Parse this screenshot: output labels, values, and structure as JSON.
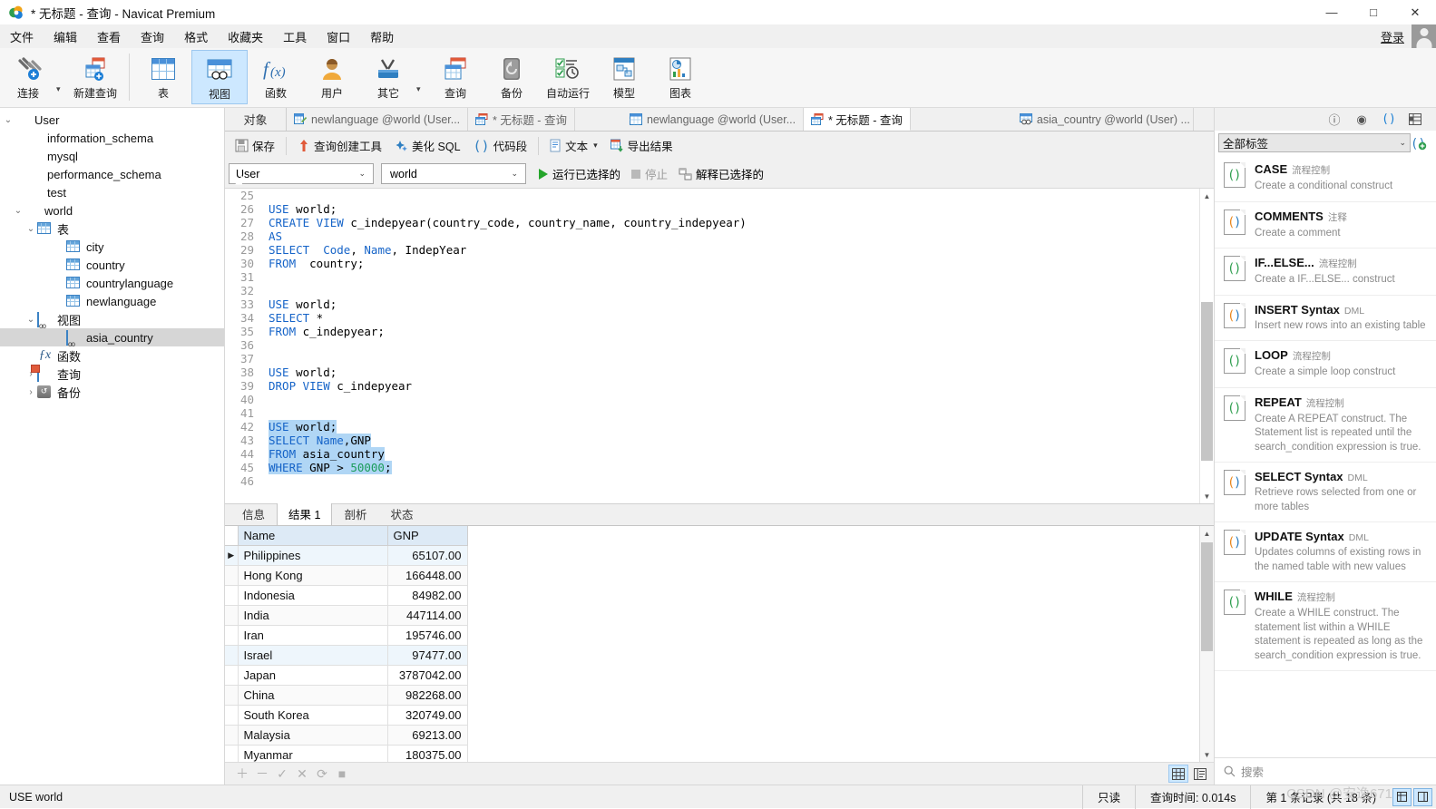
{
  "window": {
    "title": "* 无标题 - 查询 - Navicat Premium",
    "minimize": "—",
    "maximize": "□",
    "close": "✕"
  },
  "menubar": {
    "items": [
      "文件",
      "编辑",
      "查看",
      "查询",
      "格式",
      "收藏夹",
      "工具",
      "窗口",
      "帮助"
    ],
    "login_label": "登录"
  },
  "toolbar": {
    "buttons": [
      {
        "label": "连接",
        "icon": "connection-icon",
        "caret": true
      },
      {
        "label": "新建查询",
        "icon": "new-query-icon",
        "caret": false
      },
      {
        "label": "表",
        "icon": "table-icon",
        "caret": false
      },
      {
        "label": "视图",
        "icon": "view-icon",
        "caret": false,
        "active": true
      },
      {
        "label": "函数",
        "icon": "function-icon",
        "caret": false
      },
      {
        "label": "用户",
        "icon": "user-icon",
        "caret": false
      },
      {
        "label": "其它",
        "icon": "other-tools-icon",
        "caret": true
      },
      {
        "label": "查询",
        "icon": "query-icon",
        "caret": false
      },
      {
        "label": "备份",
        "icon": "backup-icon",
        "caret": false
      },
      {
        "label": "自动运行",
        "icon": "automation-icon",
        "caret": false
      },
      {
        "label": "模型",
        "icon": "model-icon",
        "caret": false
      },
      {
        "label": "图表",
        "icon": "chart-icon",
        "caret": false
      }
    ]
  },
  "sidebar": {
    "nodes": [
      {
        "label": "User",
        "level": 0,
        "icon": "navicat-connection-icon",
        "twist": "v"
      },
      {
        "label": "information_schema",
        "level": 1,
        "icon": "database-icon",
        "twist": ""
      },
      {
        "label": "mysql",
        "level": 1,
        "icon": "database-icon",
        "twist": ""
      },
      {
        "label": "performance_schema",
        "level": 1,
        "icon": "database-icon",
        "twist": ""
      },
      {
        "label": "test",
        "level": 1,
        "icon": "database-icon",
        "twist": ""
      },
      {
        "label": "world",
        "level": 1,
        "icon": "database-icon-open",
        "twist": "v"
      },
      {
        "label": "表",
        "level": 2,
        "icon": "tables-folder-icon",
        "twist": "v"
      },
      {
        "label": "city",
        "level": 3,
        "icon": "table-icon",
        "twist": ""
      },
      {
        "label": "country",
        "level": 3,
        "icon": "table-icon",
        "twist": ""
      },
      {
        "label": "countrylanguage",
        "level": 3,
        "icon": "table-icon",
        "twist": ""
      },
      {
        "label": "newlanguage",
        "level": 3,
        "icon": "table-icon",
        "twist": ""
      },
      {
        "label": "视图",
        "level": 2,
        "icon": "views-folder-icon",
        "twist": "v"
      },
      {
        "label": "asia_country",
        "level": 3,
        "icon": "view-icon",
        "twist": "",
        "selected": true
      },
      {
        "label": "函数",
        "level": 2,
        "icon": "function-icon",
        "twist": ""
      },
      {
        "label": "查询",
        "level": 2,
        "icon": "query-icon",
        "twist": ">"
      },
      {
        "label": "备份",
        "level": 2,
        "icon": "backup-icon",
        "twist": ">"
      }
    ]
  },
  "tabs": {
    "object_label": "对象",
    "items": [
      {
        "label": "newlanguage @world (User...",
        "icon": "table-edit-icon",
        "active": false
      },
      {
        "label": "* 无标题 - 查询",
        "icon": "query-icon",
        "active": false
      },
      {
        "label": "newlanguage @world (User...",
        "icon": "table-icon",
        "active": false
      },
      {
        "label": "* 无标题 - 查询",
        "icon": "query-icon",
        "active": true
      },
      {
        "label": "asia_country @world (User) ...",
        "icon": "view-icon",
        "active": false
      }
    ]
  },
  "query_toolbar": {
    "save": "保存",
    "query_builder": "查询创建工具",
    "beautify_sql": "美化 SQL",
    "code_snippet": "代码段",
    "text": "文本",
    "export_result": "导出结果"
  },
  "query_bar": {
    "connection": "User",
    "database": "world",
    "run_selected": "运行已选择的",
    "stop": "停止",
    "explain_selected": "解释已选择的"
  },
  "editor": {
    "lines": [
      {
        "n": 25,
        "tokens": []
      },
      {
        "n": 26,
        "tokens": [
          {
            "t": "USE",
            "c": "kw"
          },
          {
            "t": " world;",
            "c": ""
          }
        ]
      },
      {
        "n": 27,
        "tokens": [
          {
            "t": "CREATE VIEW",
            "c": "kw"
          },
          {
            "t": " c_indepyear(country_code, country_name, country_indepyear)",
            "c": ""
          }
        ]
      },
      {
        "n": 28,
        "tokens": [
          {
            "t": "AS",
            "c": "kw"
          }
        ]
      },
      {
        "n": 29,
        "tokens": [
          {
            "t": "SELECT",
            "c": "kw"
          },
          {
            "t": "  ",
            "c": ""
          },
          {
            "t": "Code",
            "c": "kw"
          },
          {
            "t": ", ",
            "c": ""
          },
          {
            "t": "Name",
            "c": "kw"
          },
          {
            "t": ", IndepYear",
            "c": ""
          }
        ]
      },
      {
        "n": 30,
        "tokens": [
          {
            "t": "FROM",
            "c": "kw"
          },
          {
            "t": "  country;",
            "c": ""
          }
        ]
      },
      {
        "n": 31,
        "tokens": []
      },
      {
        "n": 32,
        "tokens": []
      },
      {
        "n": 33,
        "tokens": [
          {
            "t": "USE",
            "c": "kw"
          },
          {
            "t": " world;",
            "c": ""
          }
        ]
      },
      {
        "n": 34,
        "tokens": [
          {
            "t": "SELECT",
            "c": "kw"
          },
          {
            "t": " *",
            "c": ""
          }
        ]
      },
      {
        "n": 35,
        "tokens": [
          {
            "t": "FROM",
            "c": "kw"
          },
          {
            "t": " c_indepyear;",
            "c": ""
          }
        ]
      },
      {
        "n": 36,
        "tokens": []
      },
      {
        "n": 37,
        "tokens": []
      },
      {
        "n": 38,
        "tokens": [
          {
            "t": "USE",
            "c": "kw"
          },
          {
            "t": " world;",
            "c": ""
          }
        ]
      },
      {
        "n": 39,
        "tokens": [
          {
            "t": "DROP VIEW",
            "c": "kw"
          },
          {
            "t": " c_indepyear",
            "c": ""
          }
        ]
      },
      {
        "n": 40,
        "tokens": []
      },
      {
        "n": 41,
        "tokens": []
      },
      {
        "n": 42,
        "selected": true,
        "tokens": [
          {
            "t": "USE",
            "c": "kw"
          },
          {
            "t": " world;",
            "c": ""
          }
        ]
      },
      {
        "n": 43,
        "selected": true,
        "tokens": [
          {
            "t": "SELECT",
            "c": "kw"
          },
          {
            "t": " ",
            "c": ""
          },
          {
            "t": "Name",
            "c": "kw"
          },
          {
            "t": ",GNP",
            "c": ""
          }
        ]
      },
      {
        "n": 44,
        "selected": true,
        "tokens": [
          {
            "t": "FROM",
            "c": "kw"
          },
          {
            "t": " asia_country",
            "c": ""
          }
        ]
      },
      {
        "n": 45,
        "selected": true,
        "tokens": [
          {
            "t": "WHERE",
            "c": "kw"
          },
          {
            "t": " GNP > ",
            "c": ""
          },
          {
            "t": "50000",
            "c": "num"
          },
          {
            "t": ";",
            "c": ""
          }
        ]
      },
      {
        "n": 46,
        "tokens": []
      }
    ]
  },
  "result_tabs": [
    {
      "label": "信息",
      "active": false
    },
    {
      "label": "结果 1",
      "active": true
    },
    {
      "label": "剖析",
      "active": false
    },
    {
      "label": "状态",
      "active": false
    }
  ],
  "result_grid": {
    "columns": [
      "Name",
      "GNP"
    ],
    "rows": [
      [
        "Philippines",
        "65107.00"
      ],
      [
        "Hong Kong",
        "166448.00"
      ],
      [
        "Indonesia",
        "84982.00"
      ],
      [
        "India",
        "447114.00"
      ],
      [
        "Iran",
        "195746.00"
      ],
      [
        "Israel",
        "97477.00"
      ],
      [
        "Japan",
        "3787042.00"
      ],
      [
        "China",
        "982268.00"
      ],
      [
        "South Korea",
        "320749.00"
      ],
      [
        "Malaysia",
        "69213.00"
      ],
      [
        "Myanmar",
        "180375.00"
      ]
    ]
  },
  "right_panel": {
    "filter_label": "全部标签",
    "search_placeholder": "搜索",
    "snippets": [
      {
        "title": "CASE",
        "tag": "流程控制",
        "desc": "Create a conditional construct",
        "color": "green"
      },
      {
        "title": "COMMENTS",
        "tag": "注释",
        "desc": "Create a comment",
        "color": "orange"
      },
      {
        "title": "IF...ELSE...",
        "tag": "流程控制",
        "desc": "Create a IF...ELSE... construct",
        "color": "green"
      },
      {
        "title": "INSERT Syntax",
        "tag": "DML",
        "desc": "Insert new rows into an existing table",
        "color": "orange"
      },
      {
        "title": "LOOP",
        "tag": "流程控制",
        "desc": "Create a simple loop construct",
        "color": "green"
      },
      {
        "title": "REPEAT",
        "tag": "流程控制",
        "desc": "Create A REPEAT construct. The Statement list is repeated until the search_condition expression is true.",
        "color": "green"
      },
      {
        "title": "SELECT Syntax",
        "tag": "DML",
        "desc": "Retrieve rows selected from one or more tables",
        "color": "orange"
      },
      {
        "title": "UPDATE Syntax",
        "tag": "DML",
        "desc": "Updates columns of existing rows in the named table with new values",
        "color": "orange"
      },
      {
        "title": "WHILE",
        "tag": "流程控制",
        "desc": "Create a WHILE construct. The statement list within a WHILE statement is repeated as long as the search_condition expression is true.",
        "color": "green"
      }
    ]
  },
  "statusbar": {
    "left": "USE world",
    "readonly": "只读",
    "query_time": "查询时间: 0.014s",
    "record_info": "第 1 条记录 (共 18 条)"
  },
  "watermark": "CSDN @安逸671"
}
